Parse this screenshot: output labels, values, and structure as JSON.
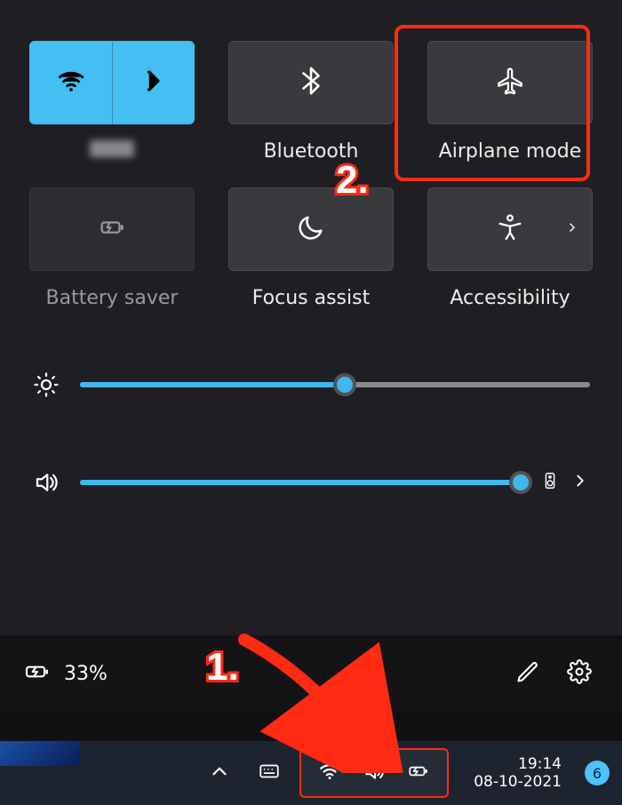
{
  "tiles": {
    "wifi": {
      "label": "",
      "network_name": "████"
    },
    "bluetooth": {
      "label": "Bluetooth"
    },
    "airplane": {
      "label": "Airplane mode"
    },
    "battery_saver": {
      "label": "Battery saver"
    },
    "focus_assist": {
      "label": "Focus assist"
    },
    "accessibility": {
      "label": "Accessibility"
    }
  },
  "sliders": {
    "brightness": {
      "percent": 52
    },
    "volume": {
      "percent": 100
    }
  },
  "footer": {
    "battery_text": "33%"
  },
  "taskbar": {
    "time": "19:14",
    "date": "08-10-2021",
    "notif_count": "6"
  },
  "annotations": {
    "step1": "1.",
    "step2": "2."
  },
  "colors": {
    "accent": "#43bff2",
    "highlight": "#ff2b12"
  }
}
